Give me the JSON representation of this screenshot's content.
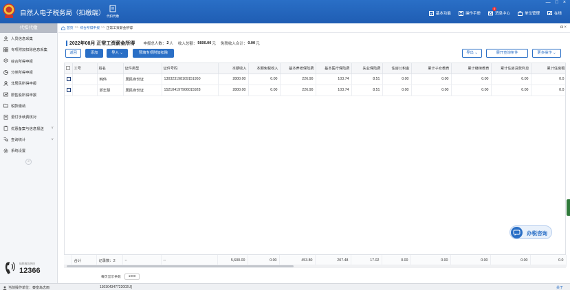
{
  "app": {
    "title": "自然人电子税务局（扣缴端）",
    "top_func_label": "代扣代缴",
    "nav": [
      {
        "label": "基本功能",
        "icon": "basic-function-icon"
      },
      {
        "label": "操作手册",
        "icon": "manual-icon"
      },
      {
        "label": "消息中心",
        "icon": "message-icon",
        "badge": "0"
      },
      {
        "label": "单位管理",
        "icon": "unit-icon"
      },
      {
        "label": "在线",
        "icon": "online-icon"
      }
    ],
    "window_controls": [
      "—",
      "□",
      "×"
    ]
  },
  "sidebar": {
    "header": "代扣代缴",
    "items": [
      {
        "label": "人员信息采集",
        "icon": "person-icon",
        "caret": ""
      },
      {
        "label": "专项附加扣除信息采集",
        "icon": "grid-icon",
        "caret": ""
      },
      {
        "label": "综合所得申报",
        "icon": "layers-icon",
        "caret": ""
      },
      {
        "label": "分类所得申报",
        "icon": "pie-icon",
        "caret": ""
      },
      {
        "label": "非居民所得申报",
        "icon": "user-icon",
        "caret": ""
      },
      {
        "label": "限售股所得申报",
        "icon": "stock-icon",
        "caret": ""
      },
      {
        "label": "税款缴纳",
        "icon": "folder-icon",
        "caret": ""
      },
      {
        "label": "退付手续费核对",
        "icon": "document-icon",
        "caret": ""
      },
      {
        "label": "优惠备案与信息报送",
        "icon": "clipboard-icon",
        "caret": "∨"
      },
      {
        "label": "查询统计",
        "icon": "search-list-icon",
        "caret": "∨"
      },
      {
        "label": "系统设置",
        "icon": "gear-icon",
        "caret": ""
      }
    ],
    "collapse_symbol": "«",
    "hotline_label": "纳税服务热线",
    "hotline_number": "12366"
  },
  "breadcrumb": {
    "home": "首页",
    "sep": ">>",
    "level1": "综合所得申报",
    "current": "正常工资薪金所得",
    "controls": "◘ ×"
  },
  "summary": {
    "period": "2022年08月 正常工资薪金所得",
    "declare_count_label": "申报总人数：",
    "declare_count": "2",
    "declare_count_unit": "人",
    "income_label": "收入总额：",
    "income_total": "5600.00",
    "income_unit": "元",
    "exempt_label": "免税收入合计：",
    "exempt_total": "0.00",
    "exempt_unit": "元"
  },
  "buttons": {
    "back": "返回",
    "add": "添加",
    "import": "导入",
    "prefill": "预填专项附加扣除",
    "export": "导出",
    "expand_query": "展开查询条件",
    "more": "更多操作"
  },
  "table": {
    "headers": [
      "",
      "工号",
      "姓名",
      "证件类型",
      "证件号码",
      "本期收入",
      "本期免税收入",
      "基本养老保险费",
      "基本医疗保险费",
      "失业保险费",
      "住房公积金",
      "累计子女教育",
      "累计继续教育",
      "累计住房贷款利息",
      "累计住房租"
    ],
    "rows": [
      [
        "",
        "",
        "韩伟",
        "居民身份证",
        "130323198109151950",
        "2800.00",
        "0.00",
        "226.90",
        "103.74",
        "8.51",
        "0.00",
        "0.00",
        "0.00",
        "0.00",
        "0.0"
      ],
      [
        "",
        "",
        "郭志慧",
        "居民身份证",
        "152104197906015928",
        "2800.00",
        "0.00",
        "226.90",
        "103.74",
        "8.51",
        "0.00",
        "0.00",
        "0.00",
        "0.00",
        "0.0"
      ]
    ],
    "footer": [
      "",
      "合计",
      "记录数：2",
      "--",
      "--",
      "5,600.00",
      "0.00",
      "453.80",
      "207.48",
      "17.02",
      "0.00",
      "0.00",
      "0.00",
      "0.00",
      "0.0"
    ],
    "page_size_label": "每页显示条数",
    "page_size": "1000"
  },
  "consult": {
    "label": "办税咨询"
  },
  "status": {
    "unit_label": "当前操作单位：秦皇岛志雨",
    "tax_id": "130304347722002U]",
    "about": "关于"
  },
  "colors": {
    "primary": "#2a6fc6",
    "topbar": "#1f5db3"
  }
}
